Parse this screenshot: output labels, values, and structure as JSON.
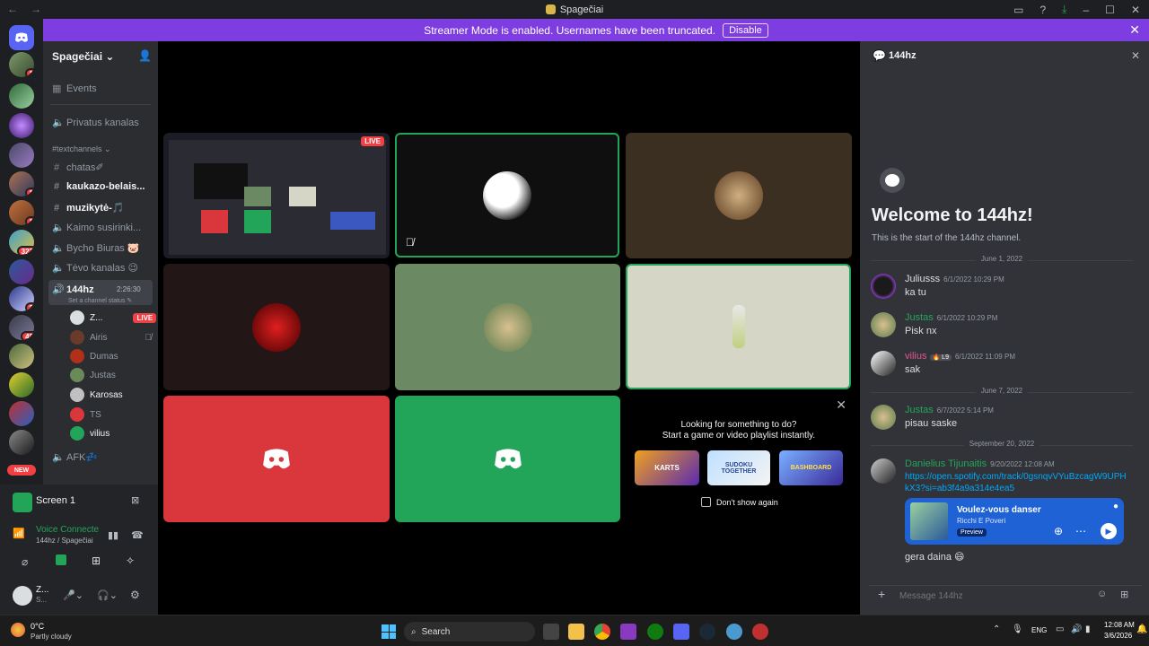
{
  "window": {
    "title": "Spagečiai"
  },
  "banner": {
    "text": "Streamer Mode is enabled. Usernames have been truncated.",
    "button": "Disable"
  },
  "guild_badges": [
    "1",
    "1",
    "1",
    "323",
    "2",
    "48"
  ],
  "guild_new": "NEW",
  "server": {
    "name": "Spagečiai"
  },
  "channels": [
    {
      "name": "Events"
    },
    {
      "name": "Privatus kanalas"
    },
    {
      "name": "#textchannels ⌄"
    },
    {
      "name": "chatas✐"
    },
    {
      "name": "kaukazo-belais..."
    },
    {
      "name": "muzikytė-🎵"
    },
    {
      "name": "Kaimo susirinki..."
    },
    {
      "name": "Bycho Biuras 🐷"
    },
    {
      "name": "Tėvo kanalas 😉"
    },
    {
      "name": "144hz"
    },
    {
      "name": "AFK💤"
    }
  ],
  "voice_channel": {
    "name": "144hz",
    "duration": "2:26:30",
    "status_placeholder": "Set a channel status ✎"
  },
  "voice_users": [
    {
      "name": "Z...",
      "live": "LIVE"
    },
    {
      "name": "Airis"
    },
    {
      "name": "Dumas"
    },
    {
      "name": "Justas"
    },
    {
      "name": "Karosas"
    },
    {
      "name": "TS"
    },
    {
      "name": "vilius"
    }
  ],
  "screen_panel": {
    "label": "Screen 1"
  },
  "voice_panel": {
    "status": "Voice Connecte",
    "location": "144hz / Spagečiai"
  },
  "user_panel": {
    "name": "Z...",
    "status": "S..."
  },
  "stage": {
    "live_label": "LIVE",
    "activity": {
      "title": "Looking for something to do?",
      "subtitle": "Start a game or video playlist instantly.",
      "dont_show": "Don't show again",
      "games": [
        "KARTS",
        "SUDOKU TOGETHER",
        "BASHBOARD"
      ]
    }
  },
  "chat": {
    "channel": "144hz",
    "welcome_title": "Welcome to 144hz!",
    "welcome_sub": "This is the start of the 144hz channel.",
    "dates": [
      "June 1, 2022",
      "June 7, 2022",
      "September 20, 2022"
    ],
    "messages": [
      {
        "name": "Juliusss",
        "time": "6/1/2022 10:29 PM",
        "text": "ka tu"
      },
      {
        "name": "Justas",
        "time": "6/1/2022 10:29 PM",
        "text": "Pisk nx"
      },
      {
        "name": "vilius",
        "tag": "🔥 L9",
        "time": "6/1/2022 11:09 PM",
        "text": "sak"
      },
      {
        "name": "Justas",
        "time": "6/7/2022 5:14 PM",
        "text": "pisau saske"
      },
      {
        "name": "Danielius Tijunaitis",
        "time": "9/20/2022 12:08 AM",
        "link": "https://open.spotify.com/track/0gsnqvVYuBzcagW9UPHkX3?si=ab3f4a9a314e4ea5"
      }
    ],
    "embed": {
      "title": "Voulez-vous danser",
      "artist": "Ricchi E Poveri",
      "preview": "Preview"
    },
    "after_embed": "gera daina 😄",
    "input_placeholder": "Message 144hz"
  },
  "taskbar": {
    "weather_temp": "0°C",
    "weather_desc": "Partly cloudy",
    "search": "Search",
    "lang": "ENG",
    "time": "12:08 AM",
    "date": "3/6/2026"
  }
}
